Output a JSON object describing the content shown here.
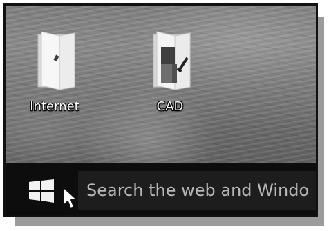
{
  "desktop": {
    "icons": [
      {
        "label": "Internet",
        "icon": "folder-with-internet-shortcut"
      },
      {
        "label": "CAD",
        "icon": "folder-with-cad-documents"
      }
    ]
  },
  "taskbar": {
    "start_icon": "windows-logo",
    "search_placeholder": "Search the web and Windo"
  },
  "colors": {
    "taskbar_bg": "#0d0d0d",
    "search_bg": "#1d1d1d",
    "label_text": "#ffffff",
    "search_text": "#b7b7b7"
  }
}
